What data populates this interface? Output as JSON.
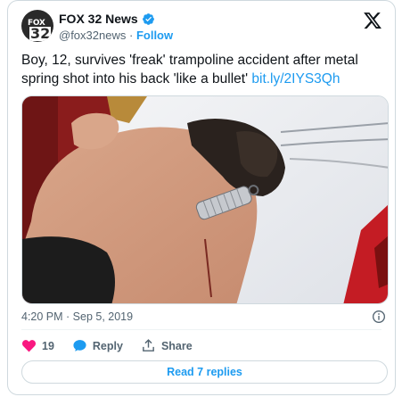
{
  "author": {
    "name": "FOX 32 News",
    "handle": "@fox32news",
    "separator": "·",
    "follow_label": "Follow",
    "avatar_top": "FOX",
    "avatar_bottom": "32"
  },
  "tweet": {
    "text": "Boy, 12, survives 'freak' trampoline accident after metal spring shot into his back 'like a bullet' ",
    "link": "bit.ly/2IYS3Qh"
  },
  "meta": {
    "timestamp": "4:20 PM · Sep 5, 2019"
  },
  "actions": {
    "like_count": "19",
    "reply_label": "Reply",
    "share_label": "Share"
  },
  "read_replies_label": "Read 7 replies",
  "colors": {
    "accent": "#1d9bf0",
    "like": "#f91880",
    "text": "#0f1419",
    "muted": "#536471"
  },
  "icons": [
    "verified-badge-icon",
    "x-logo-icon",
    "info-icon",
    "heart-icon",
    "reply-bubble-icon",
    "share-icon"
  ]
}
